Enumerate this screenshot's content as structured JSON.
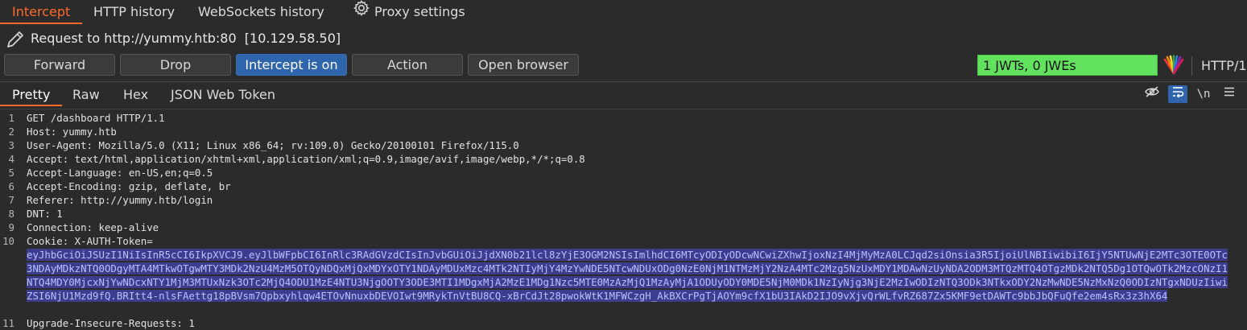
{
  "tabs": [
    "Intercept",
    "HTTP history",
    "WebSockets history",
    "Proxy settings"
  ],
  "request_line": "Request to http://yummy.htb:80  [10.129.58.50]",
  "buttons": {
    "forward": "Forward",
    "drop": "Drop",
    "intercept": "Intercept is on",
    "action": "Action",
    "open_browser": "Open browser"
  },
  "jwt_status": "1 JWTs, 0 JWEs",
  "http_version": "HTTP/1",
  "subtabs": [
    "Pretty",
    "Raw",
    "Hex",
    "JSON Web Token"
  ],
  "toolbar": {
    "newline_label": "\\n"
  },
  "lines": [
    {
      "n": "1",
      "text": "GET /dashboard HTTP/1.1"
    },
    {
      "n": "2",
      "text": "Host: yummy.htb"
    },
    {
      "n": "3",
      "text": "User-Agent: Mozilla/5.0 (X11; Linux x86_64; rv:109.0) Gecko/20100101 Firefox/115.0"
    },
    {
      "n": "4",
      "text": "Accept: text/html,application/xhtml+xml,application/xml;q=0.9,image/avif,image/webp,*/*;q=0.8"
    },
    {
      "n": "5",
      "text": "Accept-Language: en-US,en;q=0.5"
    },
    {
      "n": "6",
      "text": "Accept-Encoding: gzip, deflate, br"
    },
    {
      "n": "7",
      "text": "Referer: http://yummy.htb/login"
    },
    {
      "n": "8",
      "text": "DNT: 1"
    },
    {
      "n": "9",
      "text": "Connection: keep-alive"
    },
    {
      "n": "10",
      "text": "Cookie: X-AUTH-Token="
    },
    {
      "n": "11",
      "text": "Upgrade-Insecure-Requests: 1"
    }
  ],
  "token": "eyJhbGciOiJSUzI1NiIsInR5cCI6IkpXVCJ9.eyJlbWFpbCI6InRlc3RAdGVzdCIsInJvbGUiOiJjdXN0b21lcl8zYjE3OGM2NSIsImlhdCI6MTcyODIyODcwNCwiZXhwIjoxNzI4MjMyMzA0LCJqd2siOnsia3R5IjoiUlNBIiwibiI6IjY5NTUwNjE2MTc3OTE0OTc3NDAyMDkzNTQ0ODgyMTA4MTkwOTgwMTY3MDk2NzU4MzM5OTQyNDQxMjQxMDYxOTY1NDAyMDUxMzc4MTk2NTIyMjY4MzYwNDE5NTcwNDUxODg0NzE0NjM1NTMzMjY2NzA4MTc2Mzg5NzUxMDY1MDAwNzUyNDA2ODM3MTQzMTQ4OTgzMDk2NTQ5Dg1OTQwOTk2MzcONzI1NTQ4MDY0MjcxNjYwNDcxNTY1MjM3MTUxNzk3OTc2MjQ4ODU1MzE4NTU3NjgOOTY3ODE3MTI1MDgxMjA2MzE1MDg1Nzc5MTE0MzAzMjQ1MzAyMjA1ODUyODY0MDE5NjM0MDk1NzIyNjg3NjE2MzIwODIzNTQ3ODk3NTkxODY2NzMwNDE5NzMxNzQ0ODIzNTgxNDUzIiwiZSI6NjU1Mzd9fQ.BRItt4-nlsFAettg18pBVsm7Qpbxyhlqw4ETOvNnuxbDEVOIwt9MRykTnVtBU8CQ-xBrCdJt28pwokWtK1MFWCzgH_AkBXCrPgTjAOYm9cfX1bU3IAkD2IJO9vXjvQrWLfvRZ687Zx5KMF9etDAWTc9bbJbQFuQfe2em4sRx3z3hX64"
}
